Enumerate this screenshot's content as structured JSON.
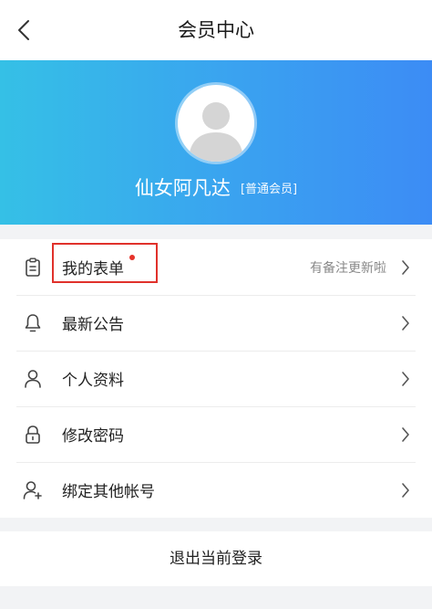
{
  "header": {
    "title": "会员中心",
    "back_icon": "chevron-left-icon"
  },
  "profile": {
    "name": "仙女阿凡达",
    "level": "[普通会员]",
    "avatar_icon": "user-avatar-icon"
  },
  "menu": {
    "items": [
      {
        "label": "我的表单",
        "icon": "clipboard-icon",
        "note": "有备注更新啦",
        "has_dot": true
      },
      {
        "label": "最新公告",
        "icon": "bell-icon",
        "note": ""
      },
      {
        "label": "个人资料",
        "icon": "person-icon",
        "note": ""
      },
      {
        "label": "修改密码",
        "icon": "lock-icon",
        "note": ""
      },
      {
        "label": "绑定其他帐号",
        "icon": "add-user-icon",
        "note": ""
      }
    ]
  },
  "logout": {
    "label": "退出当前登录"
  },
  "colors": {
    "gradient_start": "#35c0e6",
    "gradient_end": "#3c8cf5",
    "red_dot": "#e6322a",
    "highlight_border": "#e0312b"
  }
}
